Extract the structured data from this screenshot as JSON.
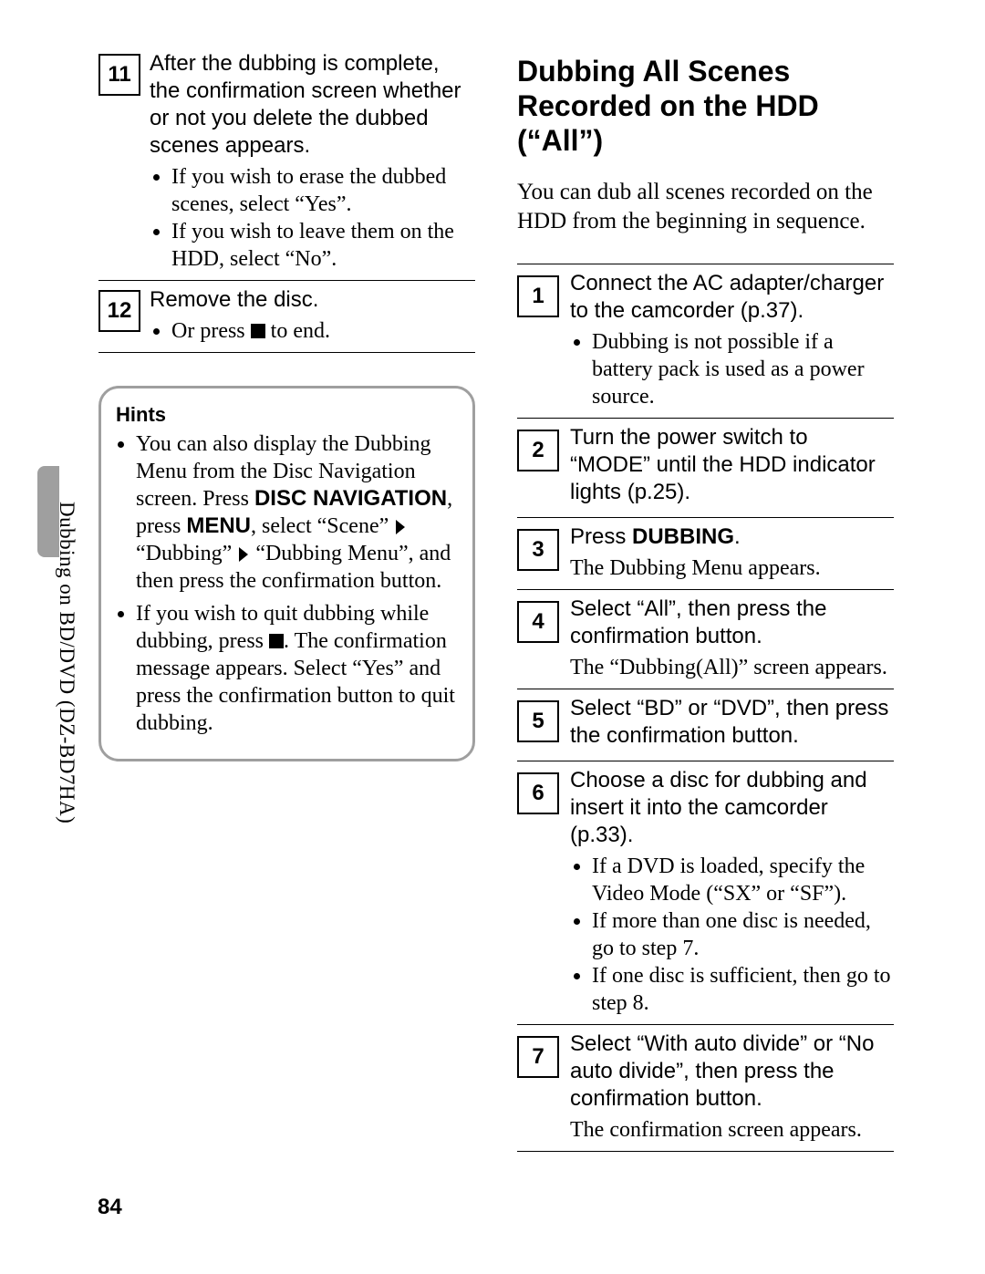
{
  "page_number": "84",
  "side_text": "Dubbing on BD/DVD (DZ-BD7HA)",
  "left": {
    "step11": {
      "num": "11",
      "lead": "After the dubbing is complete, the confirmation screen whether or not you delete the dubbed scenes appears.",
      "b1": "If you wish to erase the dubbed scenes, select “Yes”.",
      "b2": "If you wish to leave them on the HDD, select “No”."
    },
    "step12": {
      "num": "12",
      "lead": "Remove the disc.",
      "b1a": "Or press ",
      "b1b": " to end."
    },
    "hints": {
      "title": "Hints",
      "h1a": "You can also display the Dubbing Menu from the Disc Navigation screen. Press ",
      "h1b": "DISC NAVIGATION",
      "h1c": ", press ",
      "h1d": "MENU",
      "h1e": ", select “Scene” ",
      "h1f": " “Dubbing” ",
      "h1g": " “Dubbing Menu”, and then press the confirmation button.",
      "h2a": "If you wish to quit dubbing while dubbing, press ",
      "h2b": ". The confirmation message appears. Select “Yes” and press the confirmation button to quit dubbing."
    }
  },
  "right": {
    "heading": "Dubbing All Scenes Recorded on the HDD (“All”)",
    "intro": "You can dub all scenes recorded on the HDD from the beginning in sequence.",
    "s1": {
      "num": "1",
      "lead": "Connect the AC adapter/charger to the camcorder (p.37).",
      "b1": "Dubbing is not possible if a battery pack is used as a power source."
    },
    "s2": {
      "num": "2",
      "lead": "Turn the power switch to “MODE” until the HDD indicator lights (p.25)."
    },
    "s3": {
      "num": "3",
      "lead_a": "Press ",
      "lead_b": "DUBBING",
      "lead_c": ".",
      "body": "The Dubbing Menu appears."
    },
    "s4": {
      "num": "4",
      "lead": "Select “All”, then press the confirmation button.",
      "body": "The “Dubbing(All)” screen appears."
    },
    "s5": {
      "num": "5",
      "lead": "Select “BD” or “DVD”, then press the confirmation button."
    },
    "s6": {
      "num": "6",
      "lead": "Choose a disc for dubbing and insert it into the camcorder (p.33).",
      "b1": "If a DVD is loaded, specify the Video Mode (“SX” or “SF”).",
      "b2": "If more than one disc is needed, go to step 7.",
      "b3": "If one disc is sufficient, then go to step 8."
    },
    "s7": {
      "num": "7",
      "lead": "Select “With auto divide” or “No auto divide”, then press the confirmation button.",
      "body": "The confirmation screen appears."
    }
  }
}
